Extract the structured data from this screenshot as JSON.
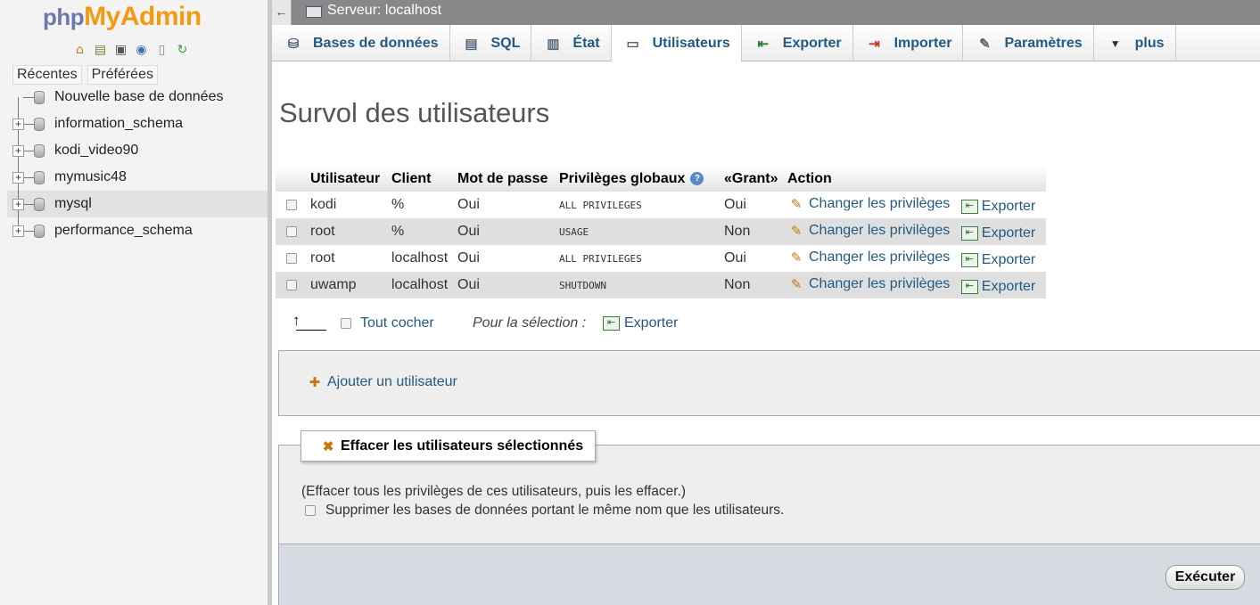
{
  "sidebar": {
    "logo_php": "php",
    "logo_myadmin": "MyAdmin",
    "icons": [
      "home-icon",
      "logout-icon",
      "query-window-icon",
      "help-icon",
      "docs-icon",
      "reload-icon"
    ],
    "tabs": [
      "Récentes",
      "Préférées"
    ],
    "new_db": "Nouvelle base de données",
    "databases": [
      "information_schema",
      "kodi_video90",
      "mymusic48",
      "mysql",
      "performance_schema"
    ],
    "selected": "mysql"
  },
  "topbar": {
    "back": "←",
    "server": "Serveur: localhost"
  },
  "tabs": [
    {
      "label": "Bases de données",
      "icon": "database-icon"
    },
    {
      "label": "SQL",
      "icon": "sql-icon"
    },
    {
      "label": "État",
      "icon": "status-icon"
    },
    {
      "label": "Utilisateurs",
      "icon": "users-icon",
      "active": true
    },
    {
      "label": "Exporter",
      "icon": "export-icon"
    },
    {
      "label": "Importer",
      "icon": "import-icon"
    },
    {
      "label": "Paramètres",
      "icon": "wrench-icon"
    },
    {
      "label": "plus",
      "icon": "triangle-down-icon"
    }
  ],
  "page": {
    "title": "Survol des utilisateurs"
  },
  "table": {
    "headers": [
      "Utilisateur",
      "Client",
      "Mot de passe",
      "Privilèges globaux",
      "«Grant»",
      "Action"
    ],
    "rows": [
      {
        "user": "kodi",
        "host": "%",
        "password": "Oui",
        "privileges": "ALL PRIVILEGES",
        "grant": "Oui"
      },
      {
        "user": "root",
        "host": "%",
        "password": "Oui",
        "privileges": "USAGE",
        "grant": "Non"
      },
      {
        "user": "root",
        "host": "localhost",
        "password": "Oui",
        "privileges": "ALL PRIVILEGES",
        "grant": "Oui"
      },
      {
        "user": "uwamp",
        "host": "localhost",
        "password": "Oui",
        "privileges": "SHUTDOWN",
        "grant": "Non"
      }
    ],
    "action_edit": "Changer les privilèges",
    "action_export": "Exporter"
  },
  "selection": {
    "check_all": "Tout cocher",
    "for_selection": "Pour la sélection :",
    "export": "Exporter"
  },
  "add_user": "Ajouter un utilisateur",
  "delete_section": {
    "legend": "Effacer les utilisateurs sélectionnés",
    "note": "(Effacer tous les privilèges de ces utilisateurs, puis les effacer.)",
    "option": "Supprimer les bases de données portant le même nom que les utilisateurs."
  },
  "execute": "Exécuter",
  "colors": {
    "link": "#235a81",
    "logo_php": "#6c78af",
    "logo_myadmin": "#f29a12",
    "topbar": "#888888"
  }
}
